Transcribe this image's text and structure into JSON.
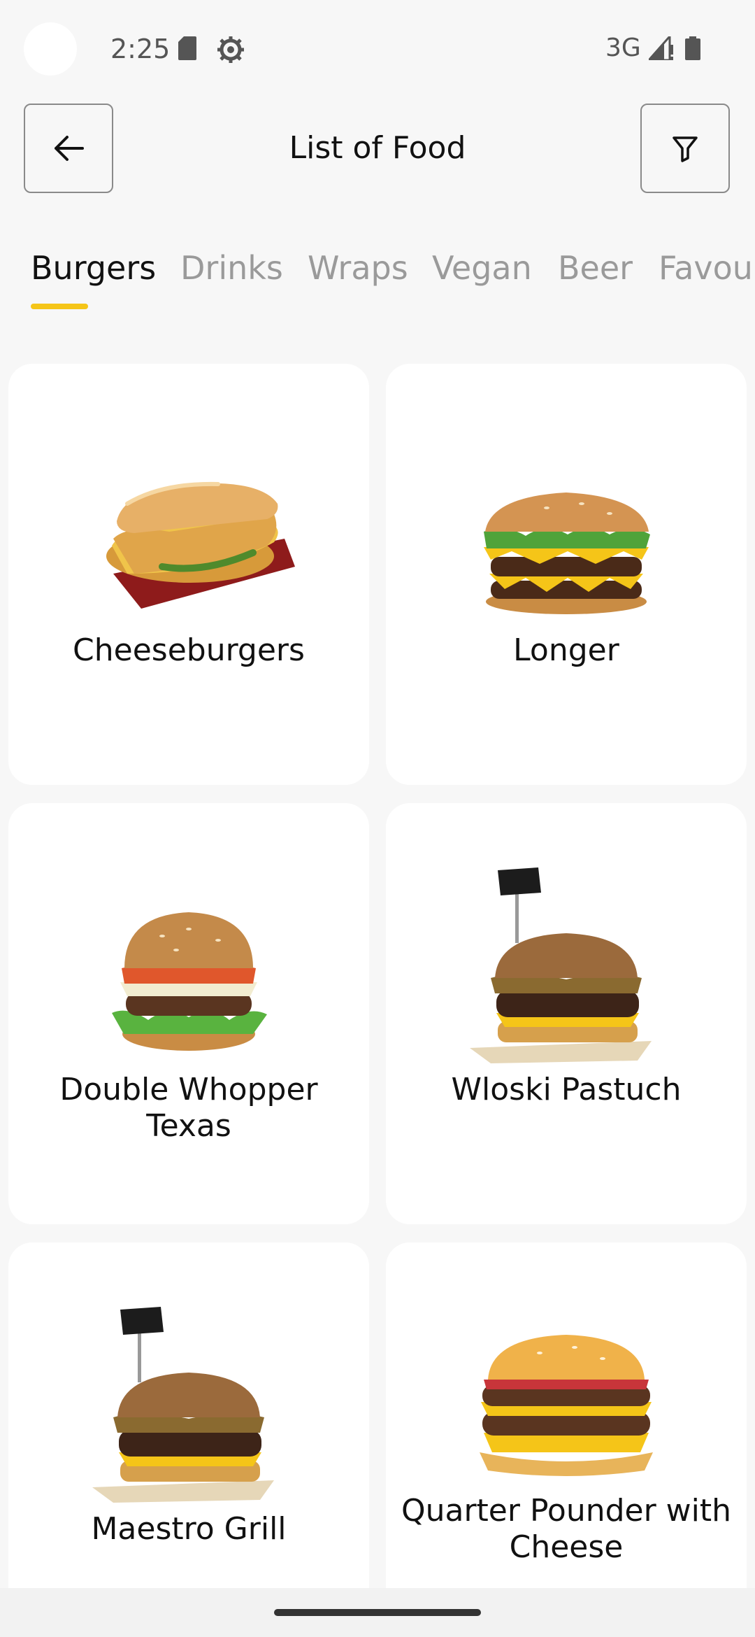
{
  "status_bar": {
    "time": "2:25",
    "network": "3G",
    "icons": [
      "sd-card-icon",
      "settings-icon",
      "signal-icon",
      "battery-icon"
    ]
  },
  "header": {
    "title": "List of Food",
    "back_icon": "arrow-left-icon",
    "filter_icon": "filter-icon"
  },
  "tabs": [
    {
      "label": "Burgers",
      "active": true
    },
    {
      "label": "Drinks",
      "active": false
    },
    {
      "label": "Wraps",
      "active": false
    },
    {
      "label": "Vegan",
      "active": false
    },
    {
      "label": "Beer",
      "active": false
    },
    {
      "label": "Favou",
      "active": false
    }
  ],
  "accent_color": "#f5c518",
  "foods": [
    {
      "name": "Cheeseburgers",
      "image": "chicken-sandwich-image"
    },
    {
      "name": "Longer",
      "image": "double-cheeseburger-image"
    },
    {
      "name": "Double Whopper Texas",
      "image": "whopper-image"
    },
    {
      "name": "Wloski Pastuch",
      "image": "flag-burger-image"
    },
    {
      "name": "Maestro Grill",
      "image": "flag-burger-image"
    },
    {
      "name": "Quarter Pounder with Cheese",
      "image": "double-cheeseburger-image"
    }
  ]
}
